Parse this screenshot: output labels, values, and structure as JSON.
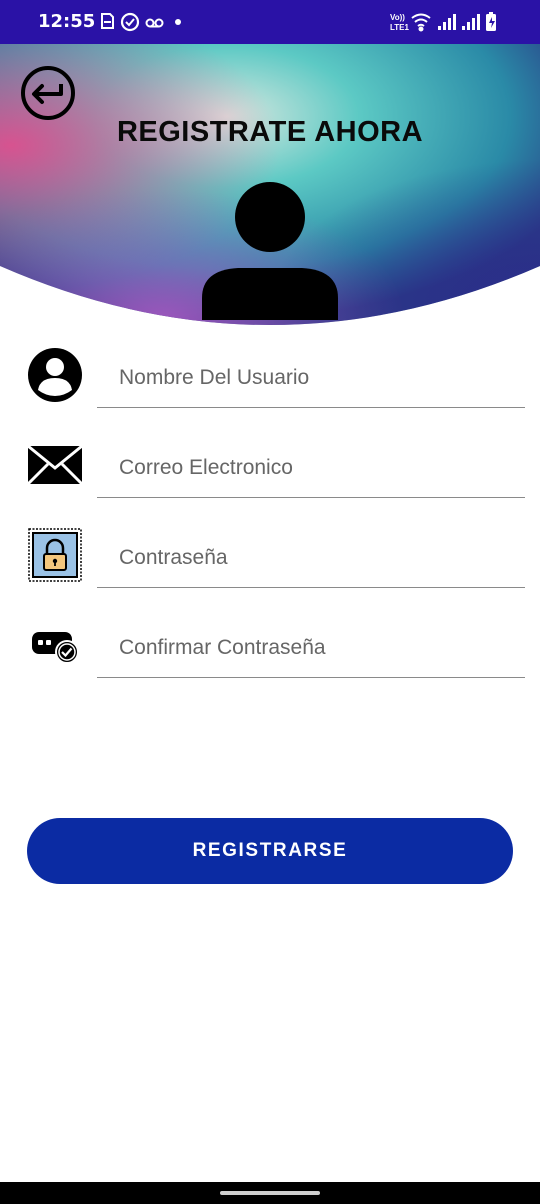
{
  "status_bar": {
    "time": "12:55",
    "left_icons": [
      "sim-icon",
      "sync-icon",
      "voicemail-icon",
      "dot-icon"
    ],
    "right_icons": [
      "volte-icon",
      "wifi-icon",
      "signal-icon",
      "signal-icon",
      "battery-charging-icon"
    ],
    "volte_text": "Vo)) LTE1"
  },
  "header": {
    "title": "REGISTRATE AHORA",
    "back_icon": "back-arrow-icon",
    "avatar_icon": "user-silhouette-icon"
  },
  "form": {
    "fields": [
      {
        "icon": "user-circle-icon",
        "placeholder": "Nombre Del Usuario",
        "value": ""
      },
      {
        "icon": "envelope-icon",
        "placeholder": "Correo Electronico",
        "value": ""
      },
      {
        "icon": "padlock-icon",
        "placeholder": "Contraseña",
        "value": ""
      },
      {
        "icon": "password-check-icon",
        "placeholder": "Confirmar Contraseña",
        "value": ""
      }
    ]
  },
  "actions": {
    "register_label": "REGISTRARSE"
  },
  "colors": {
    "status_bar": "#2a12a6",
    "button": "#0b2ba3",
    "title": "#0a0a0a"
  }
}
